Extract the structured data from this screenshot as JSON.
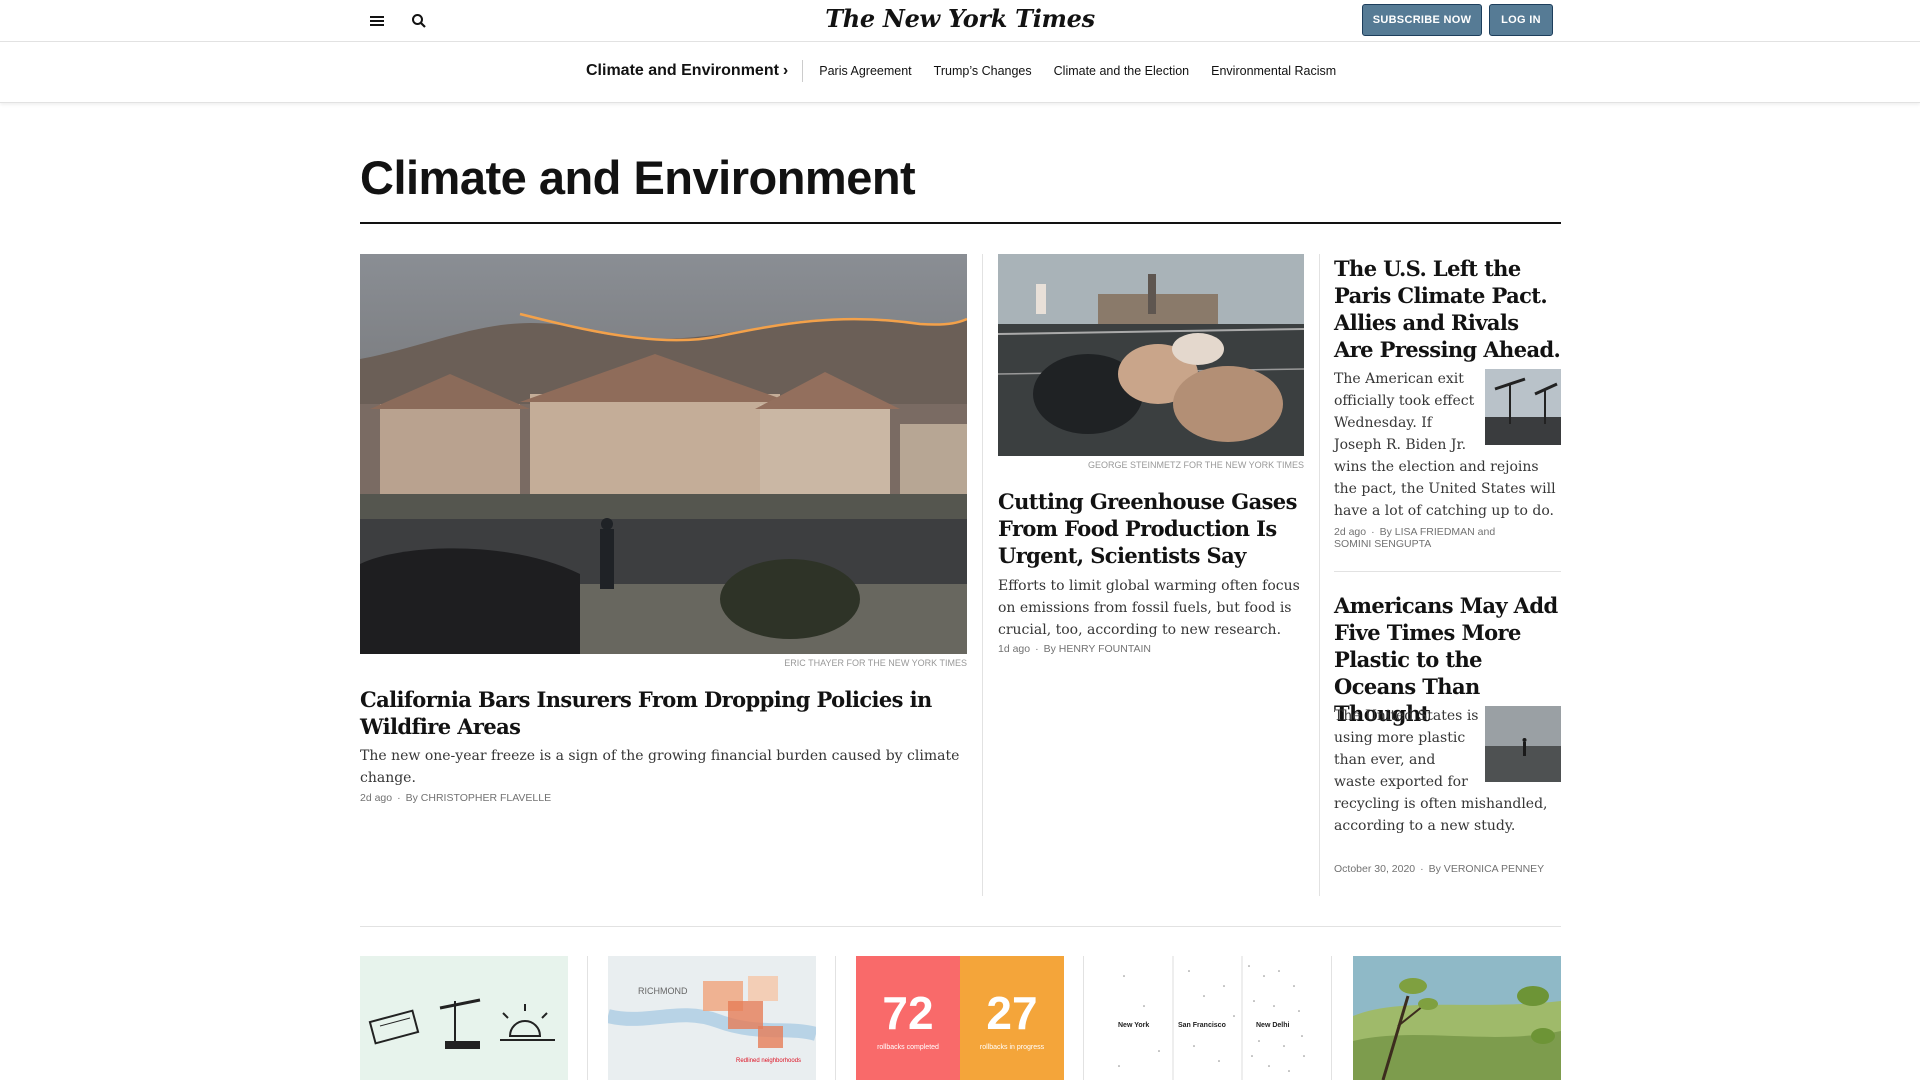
{
  "header": {
    "logo": "The New York Times",
    "subscribe_label": "SUBSCRIBE NOW",
    "login_label": "LOG IN"
  },
  "section_nav": {
    "title": "Climate and Environment",
    "links": [
      "Paris Agreement",
      "Trump’s Changes",
      "Climate and the Election",
      "Environmental Racism"
    ]
  },
  "page": {
    "title": "Climate and Environment"
  },
  "lead_story": {
    "credit": "ERIC THAYER FOR THE NEW YORK TIMES",
    "headline": "California Bars Insurers From Dropping Policies in Wildfire Areas",
    "summary": "The new one-year freeze is a sign of the growing financial burden caused by climate change.",
    "time": "2d ago",
    "byline": "By CHRISTOPHER FLAVELLE"
  },
  "second_story": {
    "credit": "GEORGE STEINMETZ FOR THE NEW YORK TIMES",
    "headline": "Cutting Greenhouse Gases From Food Production Is Urgent, Scientists Say",
    "summary": "Efforts to limit global warming often focus on emissions from fossil fuels, but food is crucial, too, according to new research.",
    "time": "1d ago",
    "byline": "By HENRY FOUNTAIN"
  },
  "side_stories": [
    {
      "headline": "The U.S. Left the Paris Climate Pact. Allies and Rivals Are Pressing Ahead.",
      "summary": "The American exit officially took effect Wednesday. If Joseph R. Biden Jr. wins the election and rejoins the pact, the United States will have a lot of catching up to do.",
      "time": "2d ago",
      "byline": "By LISA FRIEDMAN and SOMINI SENGUPTA"
    },
    {
      "headline": "Americans May Add Five Times More Plastic to the Oceans Than Thought",
      "summary": "The United States is using more plastic than ever, and waste exported for recycling is often mishandled, according to a new study.",
      "time": "October 30, 2020",
      "byline": "By VERONICA PENNEY"
    }
  ],
  "bottom_row": {
    "map_label": "RICHMOND",
    "map_callout": "Redlined neighborhoods",
    "stats": [
      {
        "value": "72",
        "label": "rollbacks completed",
        "color": "#f96a6a"
      },
      {
        "value": "27",
        "label": "rollbacks in progress",
        "color": "#f4a53a"
      }
    ],
    "cities": [
      "New York",
      "San Francisco",
      "New Delhi"
    ]
  },
  "colors": {
    "button_bg": "#567b95",
    "rule": "#e2e2e2",
    "text": "#121212"
  },
  "icons": [
    "menu-icon",
    "search-icon",
    "chevron-right-icon"
  ]
}
